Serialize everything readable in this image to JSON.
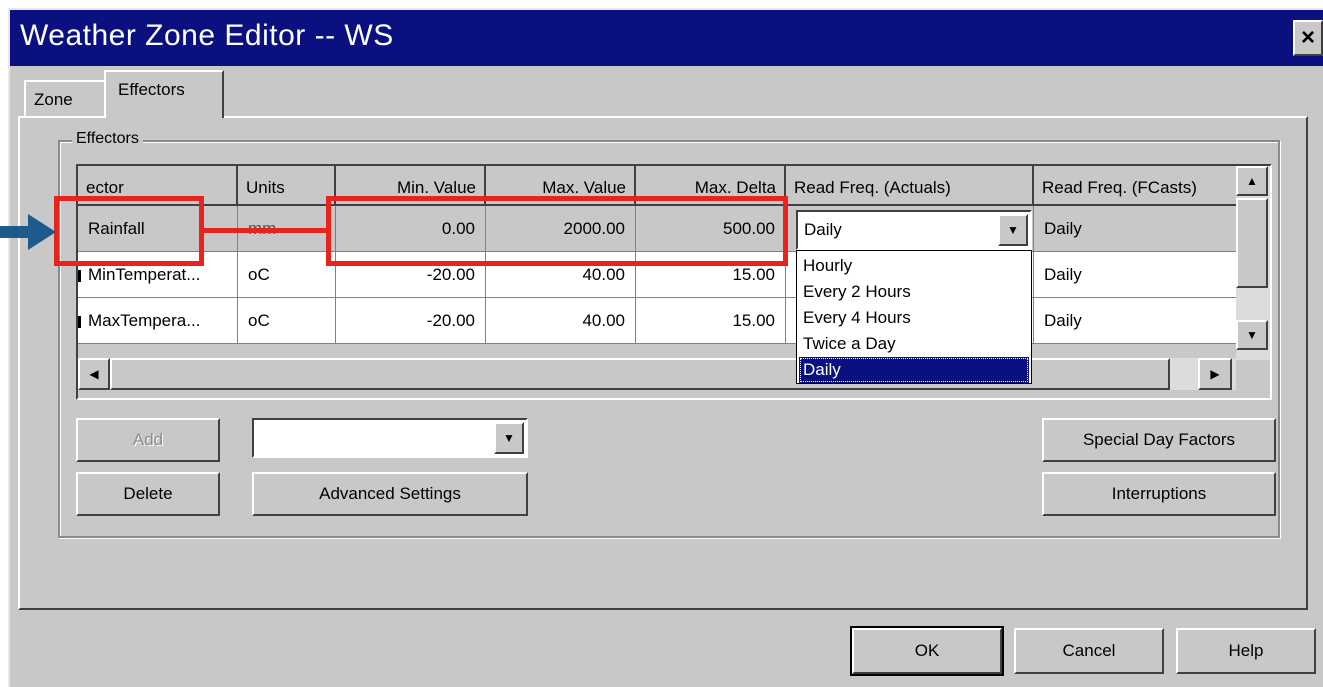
{
  "window": {
    "title": "Weather Zone Editor -- WS",
    "close_label": "×"
  },
  "tabs": [
    {
      "label": "Zone"
    },
    {
      "label": "Effectors"
    }
  ],
  "group": {
    "label": "Effectors"
  },
  "grid": {
    "columns": [
      "ector",
      "Units",
      "Min. Value",
      "Max. Value",
      "Max. Delta",
      "Read Freq. (Actuals)",
      "Read Freq. (FCasts)"
    ],
    "rows": [
      {
        "effector": "Rainfall",
        "units": "mm",
        "min": "0.00",
        "max": "2000.00",
        "delta": "500.00",
        "freq_actuals": "Daily",
        "freq_fcasts": "Daily"
      },
      {
        "effector": "MinTemperat...",
        "units": "oC",
        "min": "-20.00",
        "max": "40.00",
        "delta": "15.00",
        "freq_actuals": "",
        "freq_fcasts": "Daily"
      },
      {
        "effector": "MaxTempera...",
        "units": "oC",
        "min": "-20.00",
        "max": "40.00",
        "delta": "15.00",
        "freq_actuals": "",
        "freq_fcasts": "Daily"
      }
    ],
    "dropdown_options": [
      "Hourly",
      "Every 2 Hours",
      "Every 4 Hours",
      "Twice a Day",
      "Daily"
    ],
    "dropdown_selected": "Daily"
  },
  "buttons": {
    "add": "Add",
    "delete": "Delete",
    "advanced": "Advanced Settings",
    "special_day": "Special Day Factors",
    "interruptions": "Interruptions",
    "ok": "OK",
    "cancel": "Cancel",
    "help": "Help"
  },
  "icons": {
    "scroll_up": "▲",
    "scroll_down": "▼",
    "scroll_left": "◀",
    "scroll_right": "▶",
    "combo_arrow": "▼"
  },
  "colors": {
    "titlebar": "#0a1080",
    "face": "#c8c8c8",
    "annotation_red": "#e8231d",
    "annotation_arrow": "#1f5a8c"
  }
}
